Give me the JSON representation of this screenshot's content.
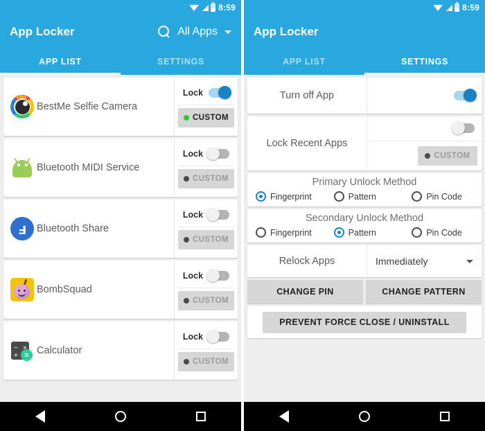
{
  "status_bar": {
    "time": "8:59",
    "icons": [
      "wifi-icon",
      "signal-icon",
      "battery-icon"
    ]
  },
  "colors": {
    "accent": "#29A8E0",
    "toggle_on_thumb": "#1b81c4",
    "toggle_on_track": "#a7d6ef",
    "chip_bg": "#d6d6d6",
    "enabled_dot": "#22d322",
    "disabled_dot": "#4a4a4a"
  },
  "left_screen": {
    "app_title": "App Locker",
    "search_icon": "search-icon",
    "filter_label": "All Apps",
    "tabs": [
      {
        "label": "APP LIST",
        "active": true
      },
      {
        "label": "SETTINGS",
        "active": false
      }
    ],
    "lock_label": "Lock",
    "custom_label": "CUSTOM",
    "apps": [
      {
        "name": "BestMe Selfie Camera",
        "icon": "bestme-selfie-camera-icon",
        "locked": true,
        "custom_enabled": true
      },
      {
        "name": "Bluetooth MIDI Service",
        "icon": "android-icon",
        "locked": false,
        "custom_enabled": false
      },
      {
        "name": "Bluetooth Share",
        "icon": "bluetooth-icon",
        "locked": false,
        "custom_enabled": false
      },
      {
        "name": "BombSquad",
        "icon": "bombsquad-icon",
        "locked": false,
        "custom_enabled": false
      },
      {
        "name": "Calculator",
        "icon": "calculator-icon",
        "locked": false,
        "custom_enabled": false
      }
    ]
  },
  "right_screen": {
    "app_title": "App Locker",
    "tabs": [
      {
        "label": "APP LIST",
        "active": false
      },
      {
        "label": "SETTINGS",
        "active": true
      }
    ],
    "turn_off_app": {
      "label": "Turn off App",
      "on": true
    },
    "lock_recent_apps": {
      "label": "Lock Recent Apps",
      "on": false,
      "custom_label": "CUSTOM",
      "custom_enabled": false
    },
    "primary_unlock": {
      "title": "Primary Unlock Method",
      "options": [
        {
          "label": "Fingerprint",
          "selected": true
        },
        {
          "label": "Pattern",
          "selected": false
        },
        {
          "label": "Pin Code",
          "selected": false
        }
      ]
    },
    "secondary_unlock": {
      "title": "Secondary Unlock Method",
      "options": [
        {
          "label": "Fingerprint",
          "selected": false
        },
        {
          "label": "Pattern",
          "selected": true
        },
        {
          "label": "Pin Code",
          "selected": false
        }
      ]
    },
    "relock": {
      "label": "Relock Apps",
      "value": "Immediately"
    },
    "buttons": {
      "change_pin": "CHANGE PIN",
      "change_pattern": "CHANGE PATTERN",
      "prevent_force_close": "PREVENT FORCE CLOSE / UNINSTALL"
    }
  },
  "nav_bar": {
    "back": "back-icon",
    "home": "home-icon",
    "recents": "recents-icon"
  }
}
